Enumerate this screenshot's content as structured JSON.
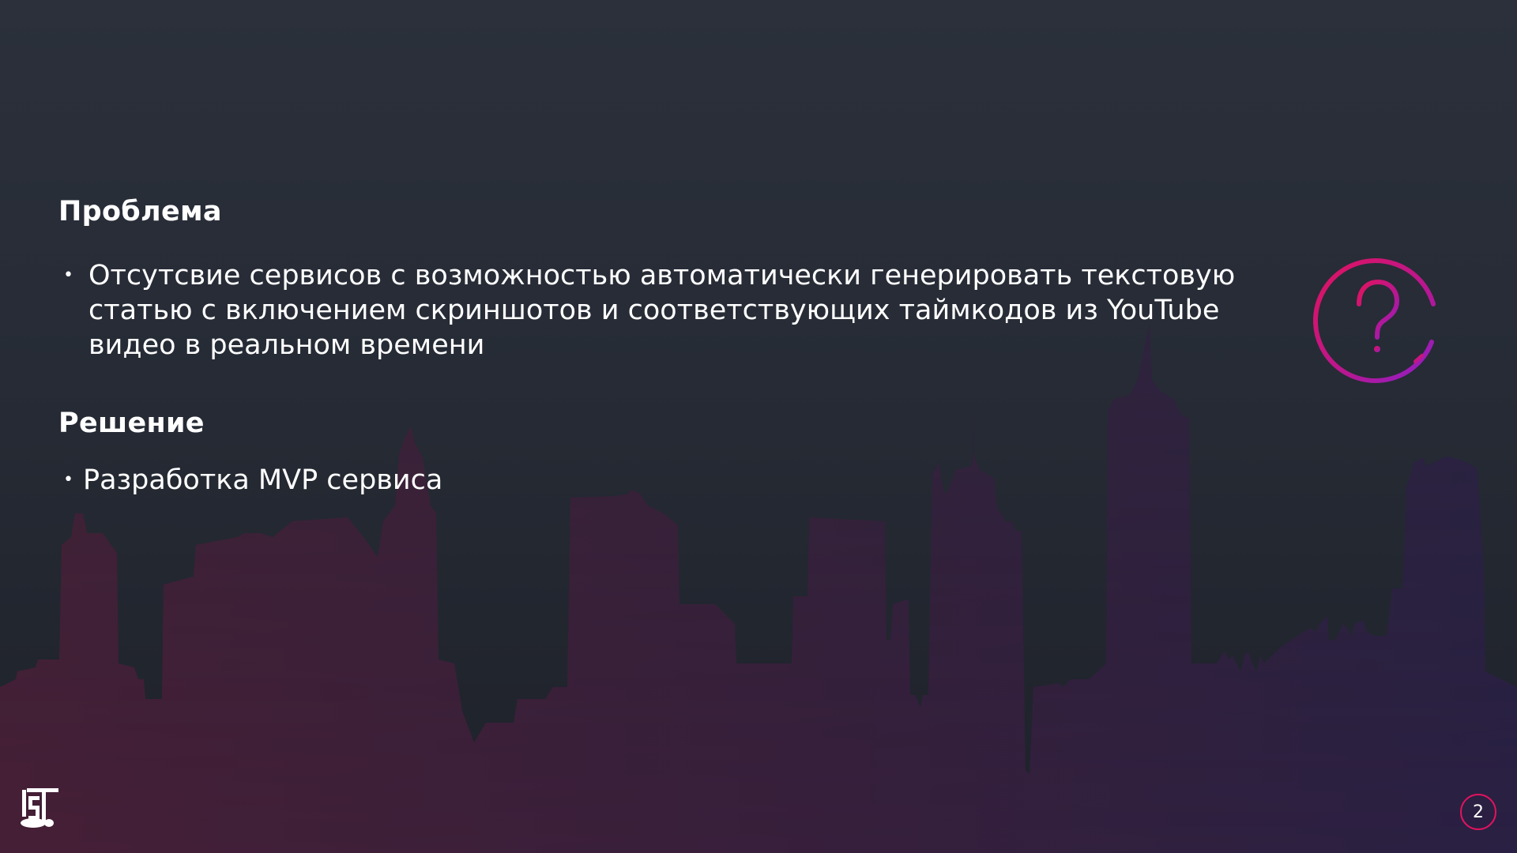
{
  "problem": {
    "heading": "Проблема",
    "bullet": "Отсутсвие сервисов с возможностью автоматически генерировать текстовую статью с включением скриншотов и соответствующих таймкодов из YouTube видео в реальном времени"
  },
  "solution": {
    "heading": "Решение",
    "bullet": "Разработка MVP сервиса"
  },
  "icons": {
    "question": "question-mark-circle-icon",
    "logo": "company-logo-icon"
  },
  "page_number": "2",
  "colors": {
    "background": "#282d37",
    "accent_pink": "#e0135e",
    "accent_purple": "#8b1fc9",
    "skyline": "#3a2038"
  }
}
